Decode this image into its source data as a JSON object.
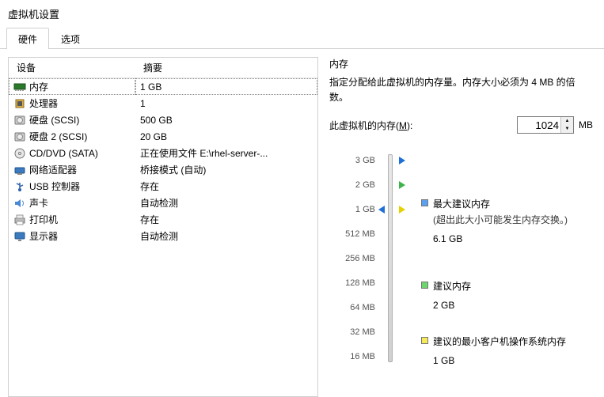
{
  "window": {
    "title": "虚拟机设置"
  },
  "tabs": {
    "hardware": "硬件",
    "options": "选项"
  },
  "deviceTable": {
    "headers": {
      "device": "设备",
      "summary": "摘要"
    },
    "rows": [
      {
        "icon": "memory-icon",
        "name": "内存",
        "summary": "1 GB",
        "selected": true
      },
      {
        "icon": "cpu-icon",
        "name": "处理器",
        "summary": "1"
      },
      {
        "icon": "disk-icon",
        "name": "硬盘 (SCSI)",
        "summary": "500 GB"
      },
      {
        "icon": "disk-icon",
        "name": "硬盘 2 (SCSI)",
        "summary": "20 GB"
      },
      {
        "icon": "cd-icon",
        "name": "CD/DVD (SATA)",
        "summary": "正在使用文件 E:\\rhel-server-..."
      },
      {
        "icon": "network-icon",
        "name": "网络适配器",
        "summary": "桥接模式 (自动)"
      },
      {
        "icon": "usb-icon",
        "name": "USB 控制器",
        "summary": "存在"
      },
      {
        "icon": "sound-icon",
        "name": "声卡",
        "summary": "自动检测"
      },
      {
        "icon": "printer-icon",
        "name": "打印机",
        "summary": "存在"
      },
      {
        "icon": "display-icon",
        "name": "显示器",
        "summary": "自动检测"
      }
    ]
  },
  "memoryPanel": {
    "title": "内存",
    "desc": "指定分配给此虚拟机的内存量。内存大小必须为 4 MB 的倍数。",
    "inputLabelPre": "此虚拟机的内存(",
    "inputAccel": "M",
    "inputLabelPost": "):",
    "inputValue": "1024",
    "unit": "MB",
    "ticks": [
      "3 GB",
      "2 GB",
      "1 GB",
      "512 MB",
      "256 MB",
      "128 MB",
      "64 MB",
      "32 MB",
      "16 MB"
    ],
    "legend": {
      "max": {
        "label": "最大建议内存",
        "note": "(超出此大小可能发生内存交换。)",
        "value": "6.1 GB"
      },
      "rec": {
        "label": "建议内存",
        "value": "2 GB"
      },
      "min": {
        "label": "建议的最小客户机操作系统内存",
        "value": "1 GB"
      }
    }
  }
}
